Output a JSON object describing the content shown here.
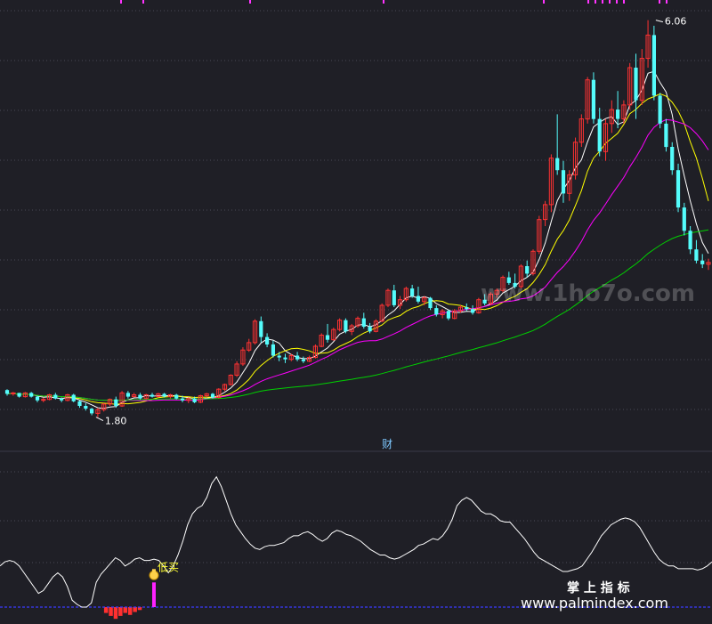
{
  "chart_data": [
    {
      "type": "candlestick",
      "title": "",
      "xlabel": "",
      "ylabel": "",
      "ylim": [
        1.5,
        6.2
      ],
      "grid": true,
      "annotations": [
        {
          "text": "6.06",
          "kind": "high",
          "index": 107,
          "value": 6.06
        },
        {
          "text": "1.80",
          "kind": "low",
          "index": 15,
          "value": 1.8
        },
        {
          "text": "财",
          "kind": "marker",
          "index": 62
        }
      ],
      "candles": [
        [
          2.09,
          2.1,
          2.03,
          2.05
        ],
        [
          2.05,
          2.07,
          2.03,
          2.06
        ],
        [
          2.06,
          2.06,
          2.01,
          2.02
        ],
        [
          2.02,
          2.07,
          2.01,
          2.06
        ],
        [
          2.06,
          2.07,
          2.01,
          2.02
        ],
        [
          2.02,
          2.03,
          1.96,
          1.98
        ],
        [
          1.98,
          2.01,
          1.96,
          1.99
        ],
        [
          1.99,
          2.05,
          1.98,
          2.04
        ],
        [
          2.04,
          2.06,
          1.99,
          2.0
        ],
        [
          2.0,
          2.01,
          1.96,
          1.98
        ],
        [
          1.98,
          2.05,
          1.97,
          2.04
        ],
        [
          2.04,
          2.05,
          1.96,
          1.97
        ],
        [
          1.97,
          1.98,
          1.9,
          1.92
        ],
        [
          1.92,
          1.95,
          1.87,
          1.89
        ],
        [
          1.89,
          1.9,
          1.82,
          1.84
        ],
        [
          1.84,
          1.9,
          1.8,
          1.88
        ],
        [
          1.88,
          1.95,
          1.86,
          1.94
        ],
        [
          1.94,
          2.0,
          1.92,
          1.99
        ],
        [
          1.99,
          2.02,
          1.9,
          1.92
        ],
        [
          1.92,
          2.08,
          1.91,
          2.06
        ],
        [
          2.06,
          2.08,
          2.0,
          2.02
        ],
        [
          2.02,
          2.06,
          2.01,
          2.04
        ],
        [
          2.04,
          2.06,
          1.99,
          2.0
        ],
        [
          2.0,
          2.05,
          1.99,
          2.04
        ],
        [
          2.04,
          2.06,
          2.01,
          2.02
        ],
        [
          2.02,
          2.06,
          2.01,
          2.05
        ],
        [
          2.05,
          2.06,
          2.01,
          2.02
        ],
        [
          2.02,
          2.05,
          2.0,
          2.04
        ],
        [
          2.04,
          2.05,
          1.99,
          2.0
        ],
        [
          2.0,
          2.03,
          1.96,
          1.98
        ],
        [
          1.98,
          2.01,
          1.95,
          2.0
        ],
        [
          2.0,
          2.02,
          1.95,
          1.96
        ],
        [
          1.96,
          2.04,
          1.95,
          2.03
        ],
        [
          2.03,
          2.06,
          2.01,
          2.05
        ],
        [
          2.05,
          2.06,
          2.0,
          2.01
        ],
        [
          2.01,
          2.11,
          2.0,
          2.1
        ],
        [
          2.1,
          2.16,
          2.08,
          2.15
        ],
        [
          2.15,
          2.26,
          2.14,
          2.25
        ],
        [
          2.25,
          2.4,
          2.23,
          2.37
        ],
        [
          2.37,
          2.55,
          2.35,
          2.52
        ],
        [
          2.52,
          2.64,
          2.5,
          2.6
        ],
        [
          2.6,
          2.85,
          2.58,
          2.83
        ],
        [
          2.83,
          2.88,
          2.6,
          2.66
        ],
        [
          2.66,
          2.7,
          2.55,
          2.58
        ],
        [
          2.58,
          2.62,
          2.44,
          2.46
        ],
        [
          2.46,
          2.5,
          2.4,
          2.44
        ],
        [
          2.44,
          2.48,
          2.38,
          2.42
        ],
        [
          2.42,
          2.48,
          2.4,
          2.46
        ],
        [
          2.46,
          2.5,
          2.4,
          2.42
        ],
        [
          2.42,
          2.45,
          2.38,
          2.4
        ],
        [
          2.4,
          2.46,
          2.39,
          2.44
        ],
        [
          2.44,
          2.58,
          2.43,
          2.56
        ],
        [
          2.56,
          2.7,
          2.55,
          2.68
        ],
        [
          2.68,
          2.8,
          2.6,
          2.63
        ],
        [
          2.63,
          2.76,
          2.62,
          2.74
        ],
        [
          2.74,
          2.86,
          2.72,
          2.84
        ],
        [
          2.84,
          2.86,
          2.7,
          2.72
        ],
        [
          2.72,
          2.8,
          2.68,
          2.78
        ],
        [
          2.78,
          2.88,
          2.76,
          2.86
        ],
        [
          2.86,
          2.92,
          2.75,
          2.77
        ],
        [
          2.77,
          2.81,
          2.7,
          2.72
        ],
        [
          2.72,
          2.85,
          2.71,
          2.83
        ],
        [
          2.83,
          3.02,
          2.82,
          3.0
        ],
        [
          3.0,
          3.18,
          2.98,
          3.16
        ],
        [
          3.16,
          3.22,
          2.98,
          3.0
        ],
        [
          3.0,
          3.1,
          2.96,
          3.06
        ],
        [
          3.06,
          3.2,
          3.04,
          3.18
        ],
        [
          3.18,
          3.22,
          3.08,
          3.1
        ],
        [
          3.1,
          3.2,
          3.02,
          3.04
        ],
        [
          3.04,
          3.1,
          3.0,
          3.08
        ],
        [
          3.08,
          3.09,
          2.95,
          2.97
        ],
        [
          2.97,
          3.0,
          2.88,
          2.9
        ],
        [
          2.9,
          2.96,
          2.86,
          2.94
        ],
        [
          2.94,
          2.95,
          2.84,
          2.86
        ],
        [
          2.86,
          2.96,
          2.85,
          2.94
        ],
        [
          2.94,
          3.0,
          2.92,
          2.98
        ],
        [
          2.98,
          3.02,
          2.94,
          2.96
        ],
        [
          2.96,
          3.0,
          2.9,
          2.92
        ],
        [
          2.92,
          3.08,
          2.91,
          3.06
        ],
        [
          3.06,
          3.12,
          3.0,
          3.02
        ],
        [
          3.02,
          3.14,
          3.0,
          3.12
        ],
        [
          3.12,
          3.18,
          3.08,
          3.16
        ],
        [
          3.16,
          3.32,
          3.14,
          3.3
        ],
        [
          3.3,
          3.36,
          3.22,
          3.24
        ],
        [
          3.24,
          3.34,
          3.18,
          3.2
        ],
        [
          3.2,
          3.44,
          3.18,
          3.42
        ],
        [
          3.42,
          3.48,
          3.3,
          3.34
        ],
        [
          3.34,
          3.6,
          3.32,
          3.58
        ],
        [
          3.58,
          3.96,
          3.55,
          3.92
        ],
        [
          3.92,
          4.12,
          3.85,
          4.08
        ],
        [
          4.08,
          4.62,
          4.0,
          4.58
        ],
        [
          4.58,
          5.05,
          4.4,
          4.45
        ],
        [
          4.45,
          4.55,
          4.1,
          4.2
        ],
        [
          4.2,
          4.45,
          4.12,
          4.4
        ],
        [
          4.4,
          4.8,
          4.35,
          4.75
        ],
        [
          4.75,
          5.05,
          4.7,
          5.0
        ],
        [
          5.0,
          5.45,
          4.95,
          5.42
        ],
        [
          5.42,
          5.5,
          4.95,
          5.0
        ],
        [
          5.0,
          5.12,
          4.6,
          4.65
        ],
        [
          4.65,
          5.0,
          4.55,
          4.95
        ],
        [
          4.95,
          5.2,
          4.85,
          5.1
        ],
        [
          5.1,
          5.3,
          4.9,
          5.0
        ],
        [
          5.0,
          5.2,
          4.95,
          5.15
        ],
        [
          5.15,
          5.6,
          5.1,
          5.55
        ],
        [
          5.55,
          5.7,
          5.0,
          5.2
        ],
        [
          5.2,
          5.75,
          5.15,
          5.65
        ],
        [
          5.65,
          6.06,
          5.55,
          5.9
        ],
        [
          5.9,
          6.0,
          5.2,
          5.25
        ],
        [
          5.25,
          5.28,
          4.9,
          4.95
        ],
        [
          4.95,
          5.0,
          4.65,
          4.7
        ],
        [
          4.7,
          4.75,
          4.4,
          4.45
        ],
        [
          4.45,
          4.52,
          4.0,
          4.05
        ],
        [
          4.05,
          4.1,
          3.75,
          3.8
        ],
        [
          3.8,
          3.85,
          3.55,
          3.6
        ],
        [
          3.6,
          3.7,
          3.45,
          3.48
        ],
        [
          3.48,
          3.55,
          3.4,
          3.44
        ],
        [
          3.44,
          3.5,
          3.38,
          3.46
        ]
      ],
      "series": [
        {
          "kind": "ma",
          "period": 5,
          "color": "#ffffff"
        },
        {
          "kind": "ma",
          "period": 10,
          "color": "#ffff00"
        },
        {
          "kind": "ma",
          "period": 20,
          "color": "#ff00ff"
        },
        {
          "kind": "ma",
          "period": 60,
          "color": "#00d000"
        }
      ],
      "colors": {
        "up": "#ff3232",
        "down": "#54fcfc",
        "grid": "#4a4a55",
        "background": "#1f1f26"
      }
    },
    {
      "type": "line",
      "title": "",
      "xlabel": "",
      "ylabel": "",
      "ylim": [
        0,
        100
      ],
      "grid": true,
      "annotations": [
        {
          "text": "低买",
          "kind": "buy-signal",
          "index": 18
        }
      ],
      "series": [
        {
          "color": "#ffffff",
          "values": [
            30,
            33,
            34,
            33,
            30,
            25,
            20,
            15,
            10,
            12,
            17,
            22,
            25,
            22,
            15,
            5,
            2,
            0,
            0,
            3,
            18,
            24,
            28,
            32,
            36,
            34,
            30,
            32,
            35,
            36,
            34,
            34,
            35,
            34,
            30,
            25,
            30,
            38,
            48,
            60,
            68,
            72,
            74,
            80,
            90,
            95,
            88,
            78,
            68,
            60,
            55,
            50,
            46,
            43,
            42,
            44,
            45,
            45,
            46,
            47,
            50,
            52,
            52,
            54,
            55,
            53,
            50,
            48,
            50,
            54,
            56,
            55,
            53,
            52,
            50,
            48,
            45,
            42,
            40,
            38,
            38,
            36,
            35,
            36,
            38,
            40,
            42,
            45,
            46,
            48,
            50,
            49,
            52,
            57,
            64,
            74,
            78,
            80,
            78,
            74,
            70,
            68,
            68,
            66,
            63,
            62,
            62,
            58,
            54,
            50,
            45,
            40,
            36,
            34,
            32,
            30,
            28,
            26,
            26,
            27,
            28,
            30,
            35,
            40,
            46,
            52,
            56,
            60,
            62,
            64,
            65,
            64,
            62,
            58,
            52,
            46,
            40,
            35,
            32,
            30,
            30,
            28,
            28,
            28,
            28,
            27,
            28,
            30,
            33
          ]
        },
        {
          "kind": "baseline",
          "color": "#3a3aff",
          "values": [
            0
          ]
        }
      ],
      "bars": {
        "color": "#ff3030",
        "values": [
          0,
          0,
          0,
          0,
          0,
          0,
          0,
          0,
          0,
          0,
          0,
          0,
          0,
          0,
          0,
          0,
          0,
          0,
          0,
          0,
          0,
          0,
          6,
          9,
          12,
          9,
          6,
          8,
          5,
          3,
          0,
          0,
          0,
          0,
          0,
          0,
          0,
          0,
          0,
          0,
          0,
          0,
          0,
          0,
          0,
          0,
          0,
          0,
          0,
          0,
          0,
          0,
          0,
          0,
          0,
          0,
          0,
          0,
          0,
          0,
          0,
          0,
          0,
          0,
          0,
          0,
          0,
          0,
          0,
          0,
          0,
          0,
          0,
          0,
          0,
          0,
          0,
          0,
          0,
          0,
          0,
          0,
          0,
          0,
          0,
          0,
          0,
          0,
          0,
          0,
          0,
          0,
          0,
          0,
          0,
          0,
          0,
          0,
          0,
          0,
          0,
          0,
          0,
          0,
          0,
          0,
          0,
          0,
          0,
          0,
          0,
          0,
          0,
          0,
          0,
          0,
          0,
          0,
          0,
          0,
          0,
          0,
          0,
          0,
          0,
          0,
          0,
          0,
          0,
          0,
          0,
          0,
          0,
          0,
          0,
          0,
          0,
          0,
          0,
          0,
          0,
          0,
          0,
          0,
          0,
          0,
          0,
          0,
          0
        ]
      },
      "signal_bar": {
        "color": "#ff22ff",
        "index": 32,
        "value": 18
      }
    }
  ],
  "watermarks": [
    {
      "text": "www.1ho7o.com"
    },
    {
      "text": "掌 上 指 标"
    },
    {
      "text": "www.palmindex.com"
    }
  ]
}
